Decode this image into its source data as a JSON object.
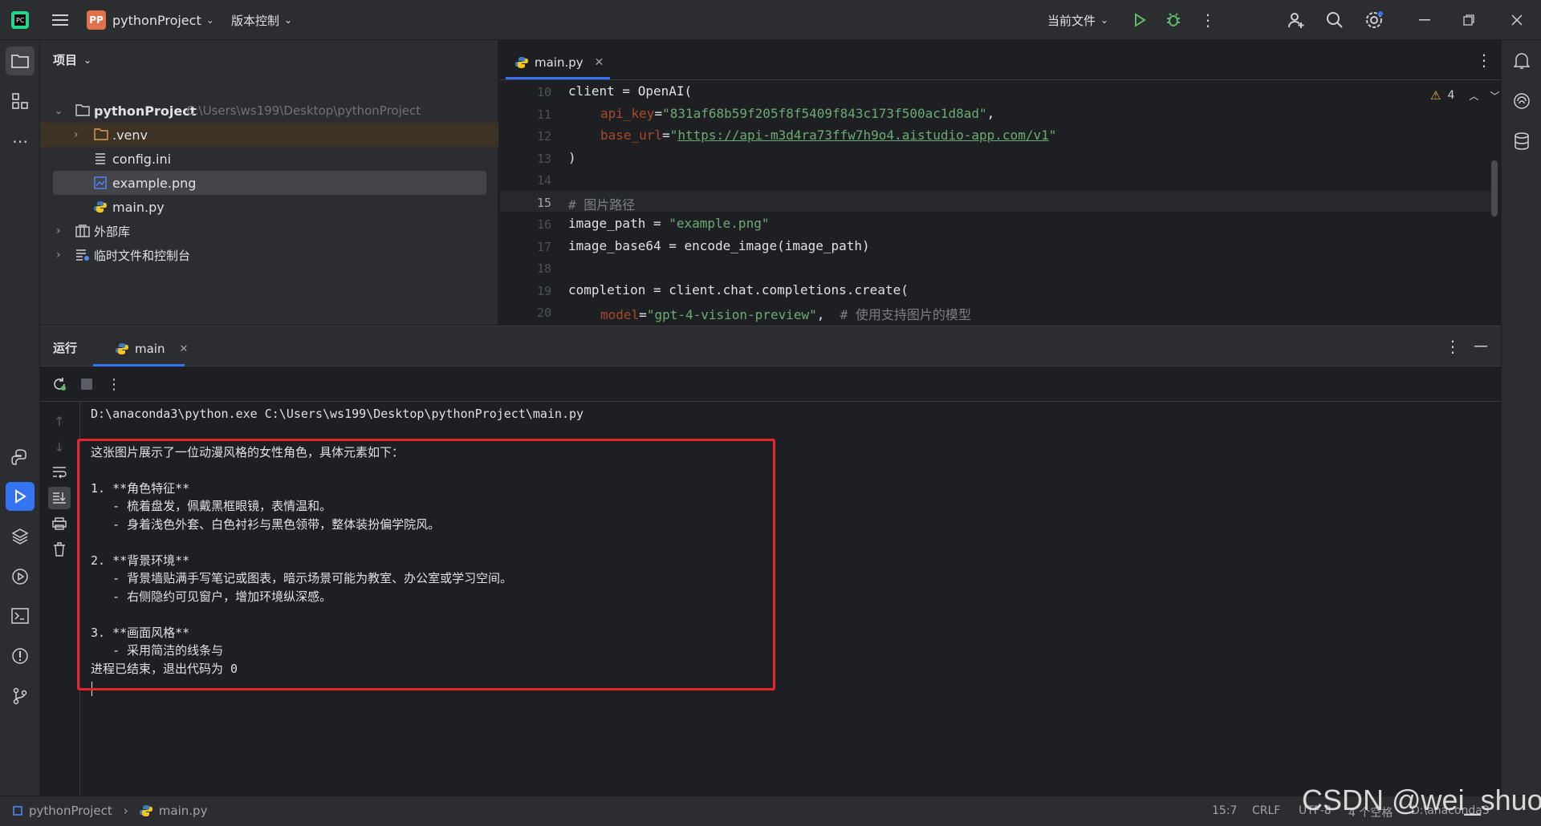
{
  "titlebar": {
    "project_initials": "PP",
    "project_name": "pythonProject",
    "vcs_label": "版本控制",
    "run_config": "当前文件"
  },
  "project_panel": {
    "title": "项目",
    "root_name": "pythonProject",
    "root_path": "C:\\Users\\ws199\\Desktop\\pythonProject",
    "items": [
      {
        "label": ".venv",
        "icon": "folder-icon"
      },
      {
        "label": "config.ini",
        "icon": "text-file-icon"
      },
      {
        "label": "example.png",
        "icon": "image-file-icon"
      },
      {
        "label": "main.py",
        "icon": "python-file-icon"
      }
    ],
    "external_libs": "外部库",
    "scratches": "临时文件和控制台"
  },
  "editor": {
    "tab_label": "main.py",
    "warnings_count": "4",
    "line_numbers": [
      "10",
      "11",
      "12",
      "13",
      "14",
      "15",
      "16",
      "17",
      "18",
      "19",
      "20"
    ],
    "current_line": "15",
    "lines": {
      "l10": "client = OpenAI(",
      "l11_key": "api_key",
      "l11_eq": "=",
      "l11_val": "\"831af68b59f205f8f5409f843c173f500ac1d8ad\"",
      "l11_end": ",",
      "l12_key": "base_url",
      "l12_eq": "=",
      "l12_q1": "\"",
      "l12_url": "https://api-m3d4ra73ffw7h9o4.aistudio-app.com/v1",
      "l12_q2": "\"",
      "l13": ")",
      "l15": "# 图片路径",
      "l16_a": "image_path = ",
      "l16_b": "\"example.png\"",
      "l17": "image_base64 = encode_image(image_path)",
      "l19": "completion = client.chat.completions.create(",
      "l20_key": "model",
      "l20_eq": "=",
      "l20_val": "\"gpt-4-vision-preview\"",
      "l20_rest": ",  ",
      "l20_comment": "# 使用支持图片的模型"
    }
  },
  "run_panel": {
    "title": "运行",
    "tab_label": "main",
    "command": "D:\\anaconda3\\python.exe C:\\Users\\ws199\\Desktop\\pythonProject\\main.py",
    "output_lines": [
      "这张图片展示了一位动漫风格的女性角色，具体元素如下：",
      "",
      "1. **角色特征**",
      "   - 梳着盘发，佩戴黑框眼镜，表情温和。",
      "   - 身着浅色外套、白色衬衫与黑色领带，整体装扮偏学院风。",
      "",
      "2. **背景环境**",
      "   - 背景墙贴满手写笔记或图表，暗示场景可能为教室、办公室或学习空间。",
      "   - 右侧隐约可见窗户，增加环境纵深感。",
      "",
      "3. **画面风格**",
      "   - 采用简洁的线条与",
      "进程已结束，退出代码为 0"
    ]
  },
  "statusbar": {
    "project": "pythonProject",
    "file": "main.py",
    "position": "15:7",
    "line_sep": "CRLF",
    "encoding": "UTF-8",
    "indent": "4 个空格",
    "interpreter": "D:\\anaconda3"
  },
  "watermark": "CSDN @wei_shuo",
  "colors": {
    "accent": "#3574f0",
    "highlight_box": "#e5272d",
    "keyword_arg": "#aa4926",
    "string": "#6aab73",
    "comment": "#7a7e85"
  }
}
